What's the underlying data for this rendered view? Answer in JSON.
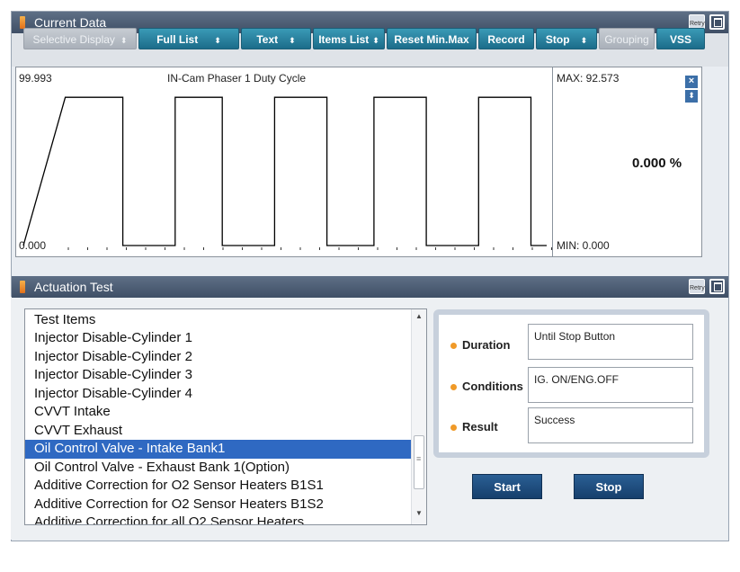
{
  "current_data_panel": {
    "title": "Current Data"
  },
  "toolbar": {
    "buttons": [
      {
        "label": "Selective Display",
        "dropdown": true,
        "enabled": false
      },
      {
        "label": "Full List",
        "dropdown": true,
        "enabled": true
      },
      {
        "label": "Text",
        "dropdown": true,
        "enabled": true
      },
      {
        "label": "Items List",
        "dropdown": true,
        "enabled": true
      },
      {
        "label": "Reset Min.Max",
        "dropdown": false,
        "enabled": true
      },
      {
        "label": "Record",
        "dropdown": false,
        "enabled": true
      },
      {
        "label": "Stop",
        "dropdown": true,
        "enabled": true
      },
      {
        "label": "Grouping",
        "dropdown": false,
        "enabled": false
      },
      {
        "label": "VSS",
        "dropdown": false,
        "enabled": true
      }
    ]
  },
  "graph": {
    "title": "IN-Cam Phaser 1 Duty Cycle",
    "y_max_label": "99.993",
    "y_min_label": "0.000",
    "max_text": "MAX: 92.573",
    "min_text": "MIN: 0.000",
    "current_value": "0.000 %"
  },
  "chart_data": {
    "type": "line",
    "title": "IN-Cam Phaser 1 Duty Cycle",
    "ylim": [
      0.0,
      99.993
    ],
    "series": [
      {
        "values": [
          0,
          92.573,
          92.573,
          0,
          0,
          92.573,
          92.573,
          0,
          0,
          92.573,
          92.573,
          0,
          0,
          92.573,
          92.573,
          0,
          0,
          92.573,
          92.573,
          0,
          0
        ],
        "x": [
          0,
          0.08,
          0.19,
          0.19,
          0.29,
          0.29,
          0.38,
          0.38,
          0.48,
          0.48,
          0.58,
          0.58,
          0.67,
          0.67,
          0.77,
          0.77,
          0.87,
          0.87,
          0.97,
          0.97,
          1.0
        ]
      }
    ],
    "grid": false,
    "line_color": "#000000"
  },
  "actuation_panel": {
    "title": "Actuation Test",
    "list_header": "Test Items",
    "items": [
      "Injector Disable-Cylinder 1",
      "Injector Disable-Cylinder 2",
      "Injector Disable-Cylinder 3",
      "Injector Disable-Cylinder 4",
      "CVVT Intake",
      "CVVT Exhaust",
      "Oil Control Valve - Intake Bank1",
      "Oil Control Valve - Exhaust Bank 1(Option)",
      "Additive Correction for O2 Sensor Heaters B1S1",
      "Additive Correction for O2 Sensor Heaters B1S2",
      "Additive Correction for all O2 Sensor Heaters"
    ],
    "selected_index": 6,
    "info": {
      "duration_label": "Duration",
      "duration_value": "Until Stop Button",
      "conditions_label": "Conditions",
      "conditions_value": "IG. ON/ENG.OFF",
      "result_label": "Result",
      "result_value": "Success"
    },
    "start_label": "Start",
    "stop_label": "Stop"
  },
  "icons": {
    "retry": "Retry",
    "maximize": "maximize-icon"
  },
  "colors": {
    "title_bar": "#4a5a72",
    "toolbar_button": "#2a86a6",
    "selection": "#2f69c2",
    "action_button": "#1f4f82",
    "bullet": "#f09a28"
  }
}
